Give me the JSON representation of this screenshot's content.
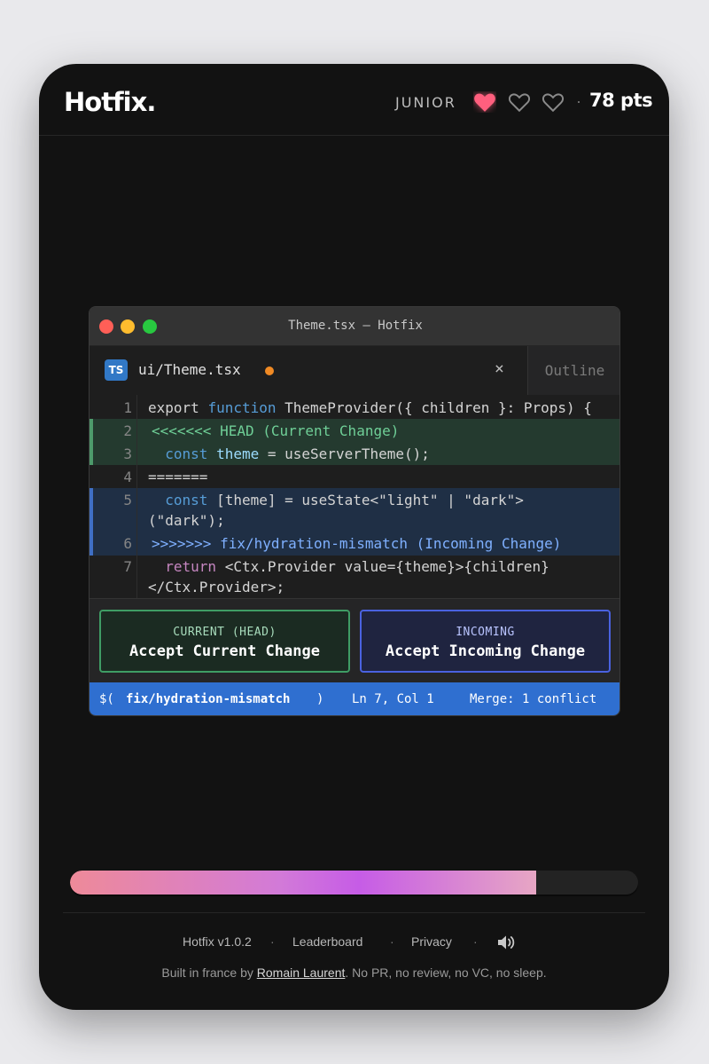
{
  "header": {
    "logo": "Hotfix.",
    "level": "JUNIOR",
    "hearts": [
      {
        "state": "filled",
        "color": "#ff5f7e"
      },
      {
        "state": "empty"
      },
      {
        "state": "empty"
      }
    ],
    "separator": "·",
    "points": "78 pts"
  },
  "window": {
    "title": "Theme.tsx — Hotfix",
    "traffic_lights": [
      "#ff5f57",
      "#febc2e",
      "#28c840"
    ],
    "tab": {
      "badge": "TS",
      "name": "ui/Theme.tsx",
      "close": "×"
    },
    "side_tab": "Outline",
    "code_lines": [
      {
        "num": "1",
        "parts": [
          {
            "t": "export ",
            "c": "plain"
          },
          {
            "t": "function ",
            "c": "kw"
          },
          {
            "t": "ThemeProvider",
            "c": "plain"
          },
          {
            "t": "({ children }: Props) {",
            "c": "plain"
          }
        ]
      },
      {
        "num": "2",
        "parts": [
          {
            "t": "<<<<<<< HEAD (Current Change)",
            "c": "cur-marker"
          }
        ]
      },
      {
        "num": "3",
        "parts": [
          {
            "t": "  const ",
            "c": "kw"
          },
          {
            "t": "theme",
            "c": "id"
          },
          {
            "t": " = ",
            "c": "plain"
          },
          {
            "t": "useServerTheme",
            "c": "plain"
          },
          {
            "t": "();",
            "c": "plain"
          }
        ]
      },
      {
        "num": "4",
        "parts": [
          {
            "t": "=======",
            "c": "plain"
          }
        ]
      },
      {
        "num": "5",
        "parts": [
          {
            "t": "  const ",
            "c": "kw"
          },
          {
            "t": "[theme]",
            "c": "plain"
          },
          {
            "t": " = ",
            "c": "plain"
          },
          {
            "t": "useState<\"light\" | \"dark\">",
            "c": "plain"
          }
        ]
      },
      {
        "num": "",
        "parts": [
          {
            "t": "(\"dark\");",
            "c": "plain"
          }
        ]
      },
      {
        "num": "6",
        "parts": [
          {
            "t": ">>>>>>> fix/hydration-mismatch (Incoming Change)",
            "c": "inc-marker"
          }
        ]
      },
      {
        "num": "7",
        "parts": [
          {
            "t": "  return ",
            "c": "kw2"
          },
          {
            "t": "<Ctx.Provider value={theme}>{children}",
            "c": "plain"
          }
        ]
      },
      {
        "num": "",
        "parts": [
          {
            "t": "</Ctx.Provider>;",
            "c": "plain"
          }
        ]
      }
    ],
    "actions": {
      "current": {
        "small": "CURRENT (HEAD)",
        "big": "Accept Current Change"
      },
      "incoming": {
        "small": "INCOMING",
        "big": "Accept Incoming Change"
      }
    },
    "status": {
      "branch_prefix": "$(",
      "branch": "fix/hydration-mismatch",
      "branch_suffix": ")",
      "position": "Ln 7, Col 1",
      "merge": "Merge: 1 conflict"
    }
  },
  "progress": {
    "fraction": 0.82
  },
  "footer": {
    "version": "Hotfix v1.0.2",
    "leaderboard": "Leaderboard",
    "privacy": "Privacy",
    "sep": "·",
    "credit_prefix": "Built in france by ",
    "author": "Romain Laurent",
    "credit_suffix": ". No PR, no review, no VC, no sleep."
  }
}
